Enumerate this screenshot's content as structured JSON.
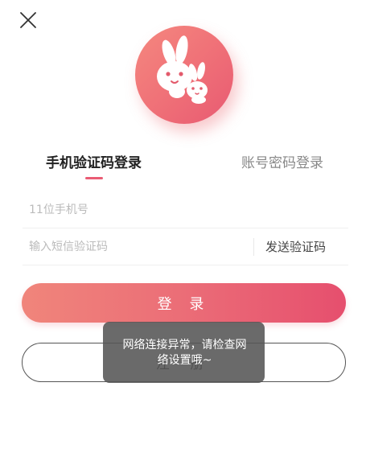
{
  "header": {
    "close_icon": "close-icon"
  },
  "logo": {
    "icon": "rabbit-logo-icon",
    "colors": {
      "start": "#f5887f",
      "end": "#e85a72"
    }
  },
  "tabs": [
    {
      "label": "手机验证码登录",
      "active": true
    },
    {
      "label": "账号密码登录",
      "active": false
    }
  ],
  "form": {
    "phone": {
      "placeholder": "11位手机号",
      "value": ""
    },
    "code": {
      "placeholder": "输入短信验证码",
      "value": ""
    },
    "send_code_label": "发送验证码"
  },
  "buttons": {
    "login_label": "登 录",
    "register_label": "注 册"
  },
  "toast": {
    "message": "网络连接异常，请检查网络设置哦~"
  },
  "colors": {
    "accent": "#ea5c74",
    "gradient_start": "#f0857b",
    "gradient_end": "#e64f6e"
  }
}
